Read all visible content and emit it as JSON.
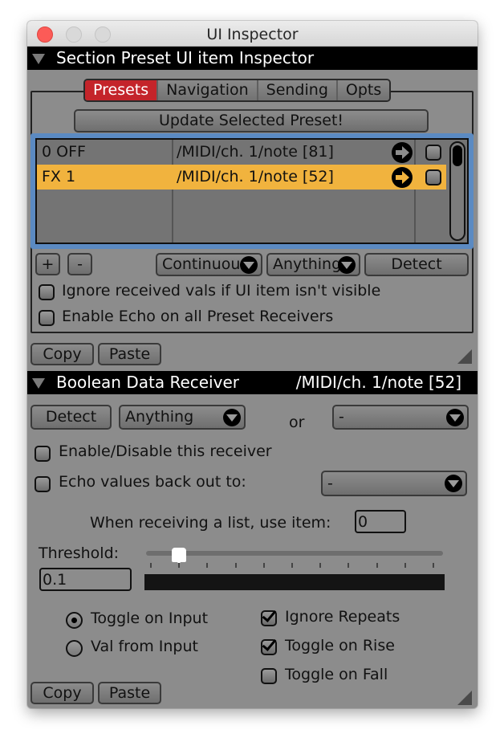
{
  "window": {
    "title": "UI Inspector"
  },
  "preset_section": {
    "header": "Section Preset UI item Inspector",
    "tabs": [
      {
        "label": "Presets",
        "active": true
      },
      {
        "label": "Navigation",
        "active": false
      },
      {
        "label": "Sending",
        "active": false
      },
      {
        "label": "Opts",
        "active": false
      }
    ],
    "update_button": "Update Selected Preset!",
    "presets": [
      {
        "name": "0 OFF",
        "address": "/MIDI/ch. 1/note [81]",
        "checked": false,
        "selected": false
      },
      {
        "name": "FX 1",
        "address": "/MIDI/ch. 1/note [52]",
        "checked": false,
        "selected": true
      }
    ],
    "add_button": "+",
    "remove_button": "-",
    "mode_dropdown": "Continuous",
    "type_dropdown": "Anything",
    "detect_button": "Detect",
    "options": [
      {
        "label": "Ignore received vals if UI item isn't visible",
        "checked": false
      },
      {
        "label": "Enable Echo on all Preset Receivers",
        "checked": false
      }
    ],
    "copy_button": "Copy",
    "paste_button": "Paste"
  },
  "receiver_section": {
    "header": "Boolean Data Receiver",
    "header_address": "/MIDI/ch. 1/note [52]",
    "detect_button": "Detect",
    "type_dropdown": "Anything",
    "or_label": "or",
    "source_dropdown": "-",
    "enable_checkbox": {
      "label": "Enable/Disable this receiver",
      "checked": false
    },
    "echo_checkbox": {
      "label": "Echo values back out to:",
      "checked": false
    },
    "echo_dropdown": "-",
    "list_item_label": "When receiving a list, use item:",
    "list_item_value": "0",
    "threshold_label": "Threshold:",
    "threshold_value": "0.1",
    "threshold_slider": {
      "min": 0,
      "max": 1,
      "value": 0.1,
      "ticks": 11
    },
    "meter_level": 0,
    "modes": [
      {
        "label": "Toggle on Input",
        "selected": true
      },
      {
        "label": "Val from Input",
        "selected": false
      }
    ],
    "flags": [
      {
        "label": "Ignore Repeats",
        "checked": true
      },
      {
        "label": "Toggle on Rise",
        "checked": true
      },
      {
        "label": "Toggle on Fall",
        "checked": false
      }
    ],
    "copy_button": "Copy",
    "paste_button": "Paste"
  },
  "colors": {
    "window_bg": "#8c8c8c",
    "active_tab": "#c4242a",
    "selected_row": "#f1b33e",
    "list_focus_border": "#5b8ac2",
    "header_bg": "#000000"
  }
}
